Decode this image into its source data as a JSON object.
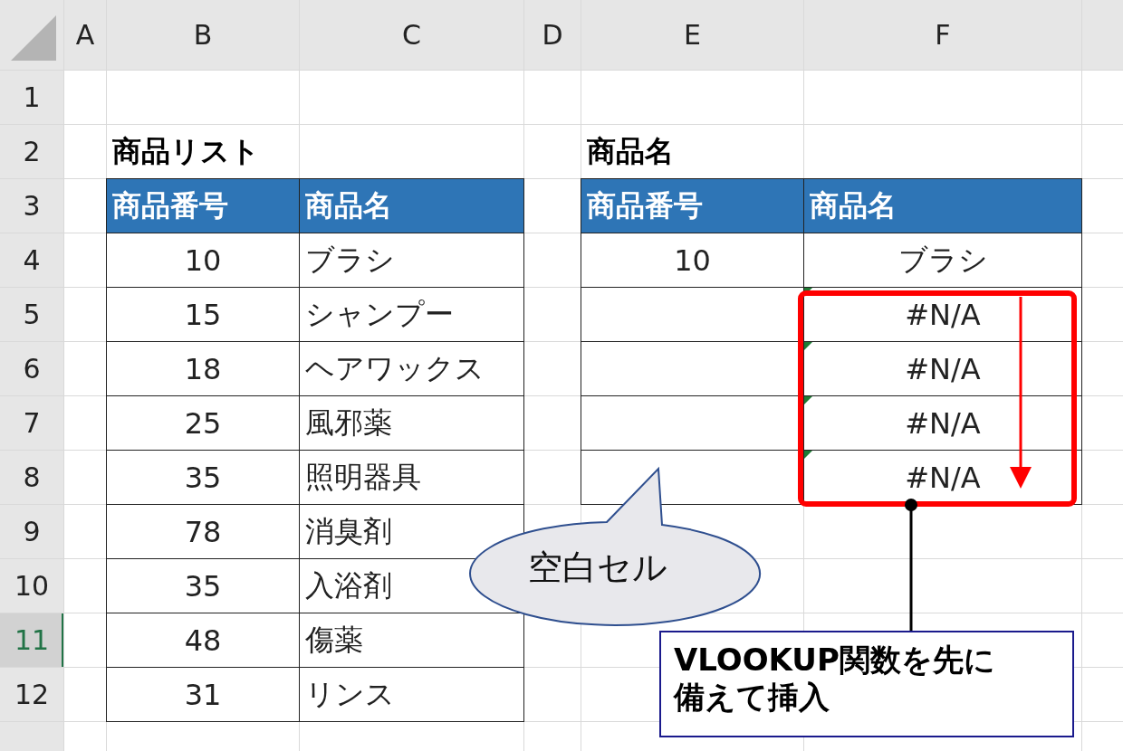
{
  "column_headers": [
    "A",
    "B",
    "C",
    "D",
    "E",
    "F"
  ],
  "rows": [
    {
      "number": "1",
      "selected": false,
      "cells": [
        {
          "kind": "blank"
        },
        {
          "kind": "blank"
        },
        {
          "kind": "blank"
        },
        {
          "kind": "blank"
        },
        {
          "kind": "blank"
        },
        {
          "kind": "blank"
        }
      ]
    },
    {
      "number": "2",
      "selected": false,
      "cells": [
        {
          "kind": "blank"
        },
        {
          "kind": "title",
          "text": "商品リスト"
        },
        {
          "kind": "blank"
        },
        {
          "kind": "blank"
        },
        {
          "kind": "title",
          "text": "商品名"
        },
        {
          "kind": "blank"
        }
      ]
    },
    {
      "number": "3",
      "selected": false,
      "cells": [
        {
          "kind": "blank"
        },
        {
          "kind": "header",
          "text": "商品番号"
        },
        {
          "kind": "header",
          "text": "商品名"
        },
        {
          "kind": "blank"
        },
        {
          "kind": "header",
          "text": "商品番号"
        },
        {
          "kind": "header",
          "text": "商品名"
        }
      ]
    },
    {
      "number": "4",
      "selected": false,
      "cells": [
        {
          "kind": "blank"
        },
        {
          "kind": "number",
          "text": "10"
        },
        {
          "kind": "text",
          "text": "ブラシ"
        },
        {
          "kind": "blank"
        },
        {
          "kind": "number",
          "text": "10"
        },
        {
          "kind": "number",
          "text": "ブラシ"
        }
      ]
    },
    {
      "number": "5",
      "selected": false,
      "cells": [
        {
          "kind": "blank"
        },
        {
          "kind": "number",
          "text": "15"
        },
        {
          "kind": "text",
          "text": "シャンプー"
        },
        {
          "kind": "blank"
        },
        {
          "kind": "empty"
        },
        {
          "kind": "error",
          "text": "#N/A"
        }
      ]
    },
    {
      "number": "6",
      "selected": false,
      "cells": [
        {
          "kind": "blank"
        },
        {
          "kind": "number",
          "text": "18"
        },
        {
          "kind": "text",
          "text": "ヘアワックス"
        },
        {
          "kind": "blank"
        },
        {
          "kind": "empty"
        },
        {
          "kind": "error",
          "text": "#N/A"
        }
      ]
    },
    {
      "number": "7",
      "selected": false,
      "cells": [
        {
          "kind": "blank"
        },
        {
          "kind": "number",
          "text": "25"
        },
        {
          "kind": "text",
          "text": "風邪薬"
        },
        {
          "kind": "blank"
        },
        {
          "kind": "empty"
        },
        {
          "kind": "error",
          "text": "#N/A"
        }
      ]
    },
    {
      "number": "8",
      "selected": false,
      "cells": [
        {
          "kind": "blank"
        },
        {
          "kind": "number",
          "text": "35"
        },
        {
          "kind": "text",
          "text": "照明器具"
        },
        {
          "kind": "blank"
        },
        {
          "kind": "empty"
        },
        {
          "kind": "error",
          "text": "#N/A"
        }
      ]
    },
    {
      "number": "9",
      "selected": false,
      "cells": [
        {
          "kind": "blank"
        },
        {
          "kind": "number",
          "text": "78"
        },
        {
          "kind": "text",
          "text": "消臭剤"
        },
        {
          "kind": "blank"
        },
        {
          "kind": "blank"
        },
        {
          "kind": "blank"
        }
      ]
    },
    {
      "number": "10",
      "selected": false,
      "cells": [
        {
          "kind": "blank"
        },
        {
          "kind": "number",
          "text": "35"
        },
        {
          "kind": "text",
          "text": "入浴剤"
        },
        {
          "kind": "blank"
        },
        {
          "kind": "blank"
        },
        {
          "kind": "blank"
        }
      ]
    },
    {
      "number": "11",
      "selected": true,
      "cells": [
        {
          "kind": "blank"
        },
        {
          "kind": "number",
          "text": "48"
        },
        {
          "kind": "text",
          "text": "傷薬"
        },
        {
          "kind": "blank"
        },
        {
          "kind": "blank"
        },
        {
          "kind": "blank"
        }
      ]
    },
    {
      "number": "12",
      "selected": false,
      "cells": [
        {
          "kind": "blank"
        },
        {
          "kind": "number",
          "text": "31"
        },
        {
          "kind": "text",
          "text": "リンス"
        },
        {
          "kind": "blank"
        },
        {
          "kind": "blank"
        },
        {
          "kind": "blank"
        }
      ]
    }
  ],
  "callout": {
    "text": "空白セル"
  },
  "note": {
    "text": "VLOOKUP関数を先に備えて挿入"
  }
}
